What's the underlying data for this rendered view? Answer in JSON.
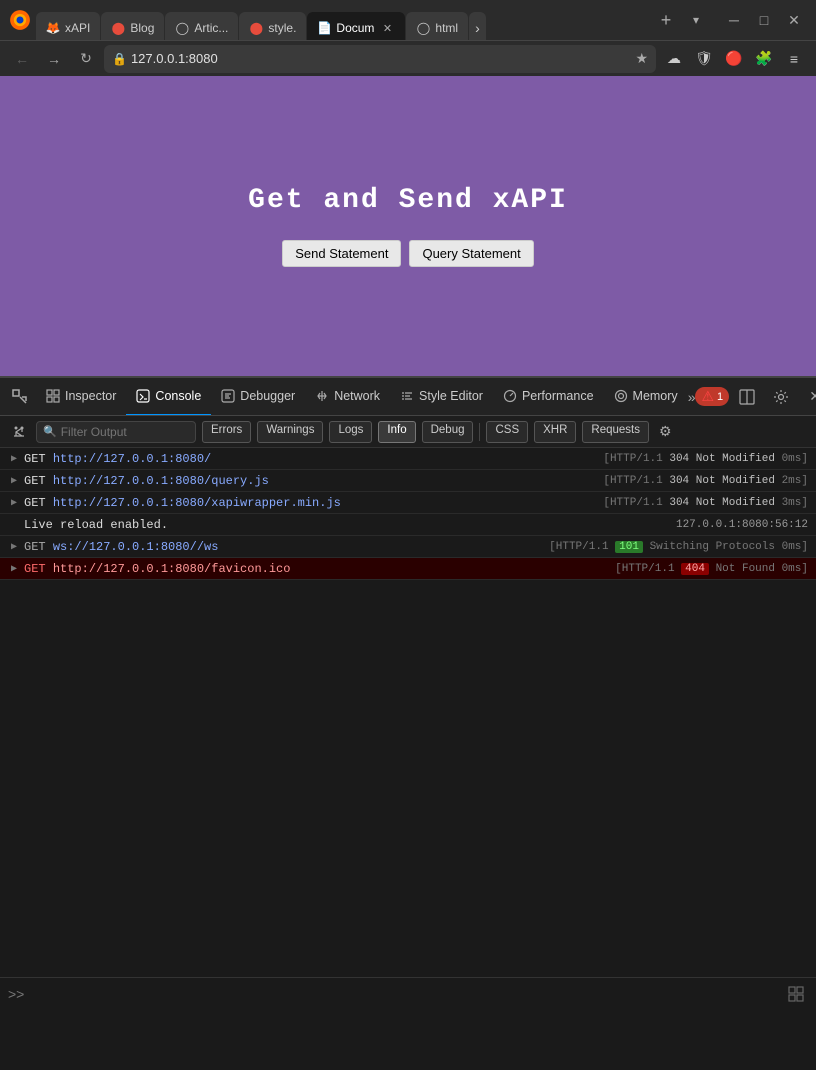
{
  "browser": {
    "tabs": [
      {
        "id": "tab1",
        "label": "xAPI",
        "favicon": "🦊",
        "active": false,
        "closable": false
      },
      {
        "id": "tab2",
        "label": "Blog",
        "favicon": "🔴",
        "active": false,
        "closable": false
      },
      {
        "id": "tab3",
        "label": "Artic...",
        "favicon": "◯",
        "active": false,
        "closable": false
      },
      {
        "id": "tab4",
        "label": "style.",
        "favicon": "📄",
        "active": false,
        "closable": false
      },
      {
        "id": "tab5",
        "label": "Docum",
        "favicon": "📄",
        "active": true,
        "closable": true
      },
      {
        "id": "tab6",
        "label": "html",
        "favicon": "◯",
        "active": false,
        "closable": false
      }
    ],
    "address": "127.0.0.1:8080",
    "new_tab_label": "+",
    "tab_list_label": "▾"
  },
  "page": {
    "title": "Get and Send xAPI",
    "send_button": "Send Statement",
    "query_button": "Query Statement",
    "background_color": "#7e5ba6"
  },
  "devtools": {
    "tabs": [
      {
        "id": "inspector",
        "label": "Inspector",
        "icon": "⬜",
        "active": false
      },
      {
        "id": "console",
        "label": "Console",
        "icon": "⬜",
        "active": true
      },
      {
        "id": "debugger",
        "label": "Debugger",
        "icon": "⬜",
        "active": false
      },
      {
        "id": "network",
        "label": "Network",
        "icon": "↕",
        "active": false
      },
      {
        "id": "style-editor",
        "label": "Style Editor",
        "icon": "{}",
        "active": false
      },
      {
        "id": "performance",
        "label": "Performance",
        "icon": "⏱",
        "active": false
      },
      {
        "id": "memory",
        "label": "Memory",
        "icon": "◯",
        "active": false
      }
    ],
    "error_count": "1",
    "filter_placeholder": "Filter Output",
    "filter_buttons": [
      {
        "id": "errors",
        "label": "Errors",
        "active": false
      },
      {
        "id": "warnings",
        "label": "Warnings",
        "active": false
      },
      {
        "id": "logs",
        "label": "Logs",
        "active": false
      },
      {
        "id": "info",
        "label": "Info",
        "active": true
      },
      {
        "id": "debug",
        "label": "Debug",
        "active": false
      },
      {
        "id": "css",
        "label": "CSS",
        "active": false
      },
      {
        "id": "xhr",
        "label": "XHR",
        "active": false
      },
      {
        "id": "requests",
        "label": "Requests",
        "active": false
      }
    ],
    "log_entries": [
      {
        "id": "log1",
        "type": "info",
        "method": "GET",
        "url": "http://127.0.0.1:8080/",
        "meta": "[HTTP/1.1 304 Not Modified 0ms]",
        "status_code": "304",
        "status_text": "Not Modified",
        "timing": "0ms",
        "http_version": "HTTP/1.1",
        "status_type": "normal"
      },
      {
        "id": "log2",
        "type": "info",
        "method": "GET",
        "url": "http://127.0.0.1:8080/query.js",
        "meta": "[HTTP/1.1 304 Not Modified 2ms]",
        "status_code": "304",
        "status_text": "Not Modified",
        "timing": "2ms",
        "http_version": "HTTP/1.1",
        "status_type": "normal"
      },
      {
        "id": "log3",
        "type": "info",
        "method": "GET",
        "url": "http://127.0.0.1:8080/xapiwrapper.min.js",
        "meta": "[HTTP/1.1 304 Not Modified 3ms]",
        "status_code": "304",
        "status_text": "Not Modified",
        "timing": "3ms",
        "http_version": "HTTP/1.1",
        "status_type": "normal"
      },
      {
        "id": "log4",
        "type": "reload",
        "method": "",
        "url": "Live reload enabled.",
        "meta": "127.0.0.1:8080:56:12",
        "status_type": "plain"
      },
      {
        "id": "log5",
        "type": "ws",
        "method": "GET",
        "url": "ws://127.0.0.1:8080//ws",
        "meta": "101 Switching Protocols 0ms",
        "status_code": "101",
        "status_text": "Switching Protocols",
        "timing": "0ms",
        "http_version": "HTTP/1.1",
        "status_type": "101"
      },
      {
        "id": "log6",
        "type": "error",
        "method": "GET",
        "url": "http://127.0.0.1:8080/favicon.ico",
        "meta": "404 Not Found 0ms",
        "status_code": "404",
        "status_text": "Not Found",
        "timing": "0ms",
        "http_version": "HTTP/1.1",
        "status_type": "404"
      }
    ]
  },
  "icons": {
    "back": "←",
    "forward": "→",
    "reload": "↻",
    "lock": "🔒",
    "star": "★",
    "pocket": "☁",
    "bitwarden": "🛡",
    "vpn": "🔴",
    "extensions": "🧩",
    "menu": "≡",
    "minimize": "─",
    "maximize": "□",
    "close": "✕",
    "chevron_right": "▶",
    "gear": "⚙",
    "clear": "🗑",
    "filter": "🔍",
    "expand_more": "»",
    "print": "⊞"
  }
}
